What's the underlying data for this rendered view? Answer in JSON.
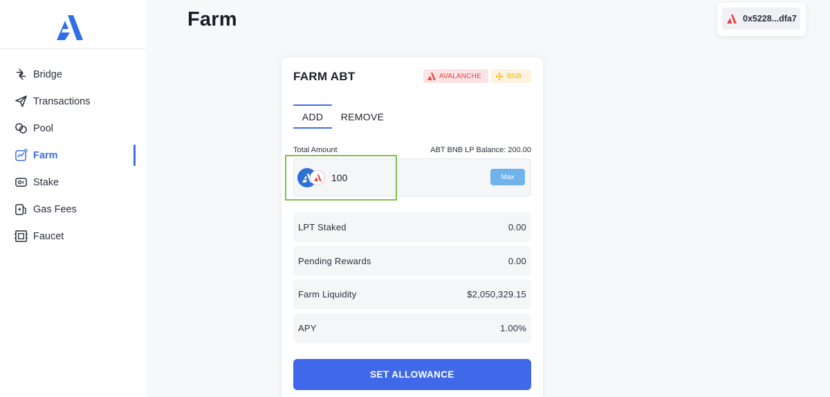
{
  "app": {
    "logo": "app-logo-icon"
  },
  "sidebar": {
    "items": [
      {
        "label": "Bridge",
        "icon": "bridge-icon",
        "active": false
      },
      {
        "label": "Transactions",
        "icon": "send-icon",
        "active": false
      },
      {
        "label": "Pool",
        "icon": "pool-icon",
        "active": false
      },
      {
        "label": "Farm",
        "icon": "chart-icon",
        "active": true
      },
      {
        "label": "Stake",
        "icon": "stake-icon",
        "active": false
      },
      {
        "label": "Gas Fees",
        "icon": "gas-icon",
        "active": false
      },
      {
        "label": "Faucet",
        "icon": "faucet-icon",
        "active": false
      }
    ]
  },
  "page": {
    "title": "Farm"
  },
  "wallet": {
    "address": "0x5228...dfa7",
    "network_icon": "avalanche-icon"
  },
  "card": {
    "title": "FARM ABT",
    "chips": {
      "avalanche": "AVALANCHE",
      "bnb": "BNB"
    },
    "tabs": {
      "add": "ADD",
      "remove": "REMOVE",
      "active": "ADD"
    },
    "amount": {
      "label": "Total Amount",
      "balance": "ABT BNB LP Balance: 200.00",
      "value": "100",
      "max_label": "Max"
    },
    "stats": [
      {
        "label": "LPT Staked",
        "value": "0.00"
      },
      {
        "label": "Pending Rewards",
        "value": "0.00"
      },
      {
        "label": "Farm Liquidity",
        "value": "$2,050,329.15"
      },
      {
        "label": "APY",
        "value": "1.00%"
      }
    ],
    "submit_label": "SET ALLOWANCE"
  },
  "colors": {
    "accent": "#3d6de8",
    "button": "#4069ea",
    "avalanche": "#e84142",
    "bnb": "#f0b90b",
    "highlight": "#7bbf4a"
  }
}
